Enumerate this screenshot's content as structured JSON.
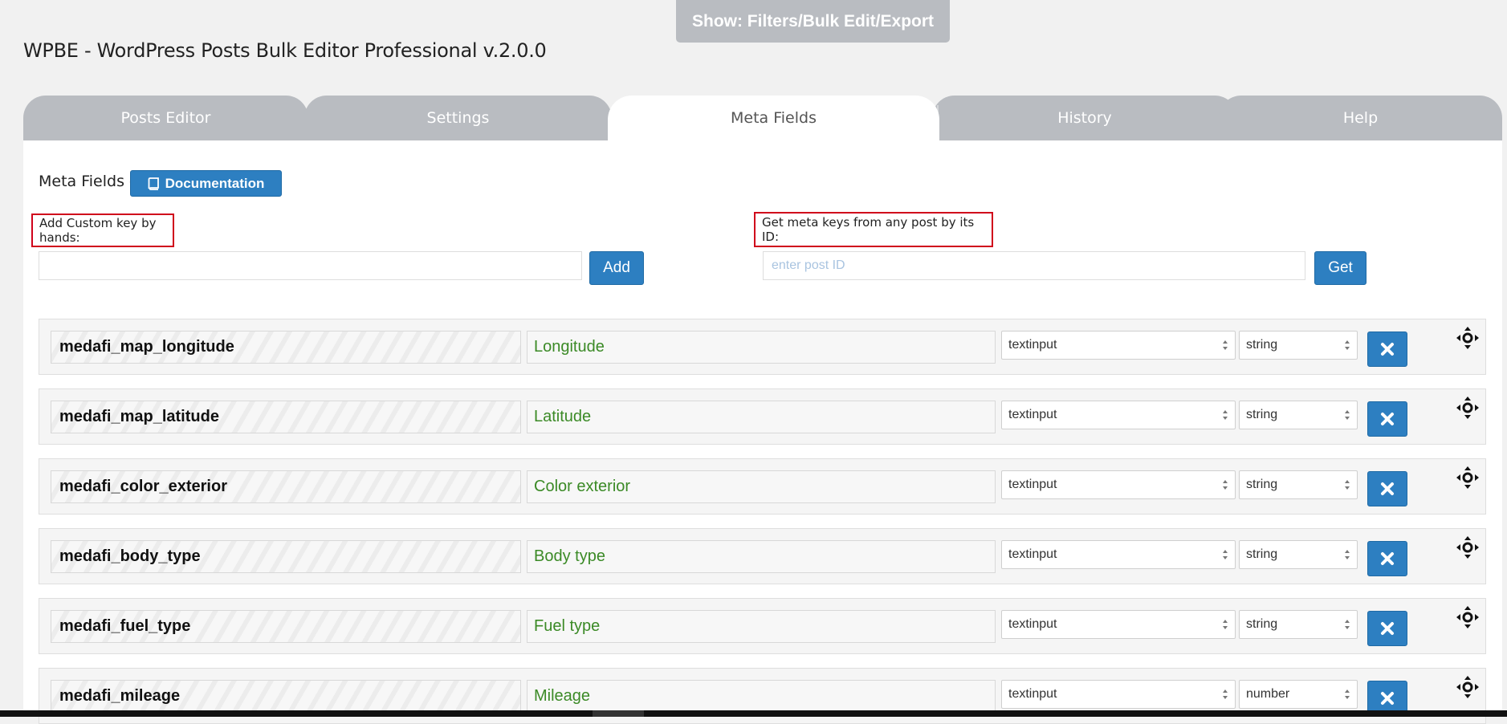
{
  "top_toggle": {
    "label": "Show: Filters/Bulk Edit/Export"
  },
  "app_title": "WPBE - WordPress Posts Bulk Editor Professional v.2.0.0",
  "tabs": [
    {
      "label": "Posts Editor",
      "active": false
    },
    {
      "label": "Settings",
      "active": false
    },
    {
      "label": "Meta Fields",
      "active": true
    },
    {
      "label": "History",
      "active": false
    },
    {
      "label": "Help",
      "active": false
    }
  ],
  "meta_section": {
    "title": "Meta Fields -",
    "doc_button": "Documentation"
  },
  "custom_key": {
    "label": "Add Custom key by hands:",
    "value": "",
    "placeholder": "",
    "button": "Add"
  },
  "post_id": {
    "label": "Get meta keys from any post by its ID:",
    "value": "",
    "placeholder": "enter post ID",
    "button": "Get"
  },
  "rows": [
    {
      "key": "medafi_map_longitude",
      "title": "Longitude",
      "field_type": "textinput",
      "value_type": "string"
    },
    {
      "key": "medafi_map_latitude",
      "title": "Latitude",
      "field_type": "textinput",
      "value_type": "string"
    },
    {
      "key": "medafi_color_exterior",
      "title": "Color exterior",
      "field_type": "textinput",
      "value_type": "string"
    },
    {
      "key": "medafi_body_type",
      "title": "Body type",
      "field_type": "textinput",
      "value_type": "string"
    },
    {
      "key": "medafi_fuel_type",
      "title": "Fuel type",
      "field_type": "textinput",
      "value_type": "string"
    },
    {
      "key": "medafi_mileage",
      "title": "Mileage",
      "field_type": "textinput",
      "value_type": "number"
    }
  ],
  "colors": {
    "accent_blue": "#2d7fc1",
    "tab_gray": "#b9bcc1",
    "title_green": "#3b8a26",
    "highlight_red": "#d0021b"
  },
  "icons": {
    "doc": "book-icon",
    "delete": "close-icon",
    "drag": "move-icon",
    "select": "sort-arrows-icon"
  }
}
